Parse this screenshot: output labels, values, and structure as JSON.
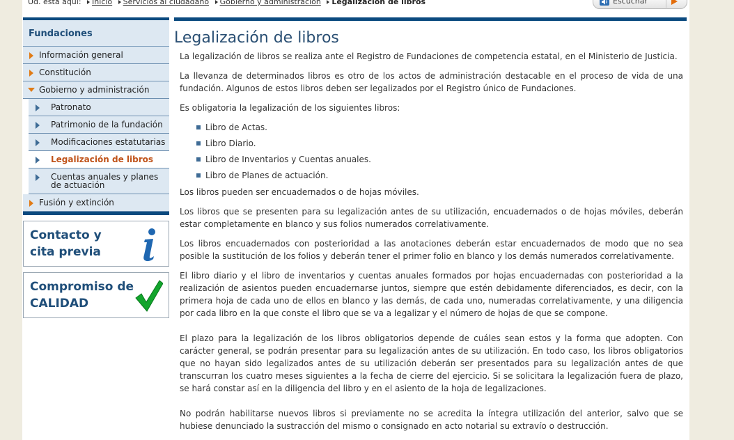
{
  "breadcrumb": {
    "prefix": "Ud. está aquí:",
    "items": [
      "Inicio",
      "Servicios al ciudadano",
      "Gobierno y administración"
    ],
    "current": "Legalización de libros"
  },
  "listen_button": {
    "label": "Escuchar"
  },
  "sidebar": {
    "heading": "Fundaciones",
    "items": [
      {
        "label": "Información general"
      },
      {
        "label": "Constitución"
      },
      {
        "label": "Gobierno y administración"
      }
    ],
    "subitems": [
      {
        "label": "Patronato"
      },
      {
        "label": "Patrimonio de la fundación"
      },
      {
        "label": "Modificaciones estatutarias"
      },
      {
        "label": "Legalización de libros"
      },
      {
        "label": "Cuentas anuales y planes de actuación"
      }
    ],
    "last_item": {
      "label": "Fusión y extinción"
    }
  },
  "promos": {
    "contact": {
      "line1": "Contacto y",
      "line2": "cita previa"
    },
    "quality": {
      "line1": "Compromiso de",
      "line2": "CALIDAD"
    }
  },
  "main": {
    "title": "Legalización de libros",
    "p1": "La legalización de libros se realiza ante el Registro de Fundaciones de competencia estatal, en el Ministerio de Justicia.",
    "p2": "La llevanza de determinados libros es otro de los actos de administración destacable en el proceso de vida de una fundación. Algunos de estos libros deben ser legalizados por el Registro único de Fundaciones.",
    "p3": "Es obligatoria la legalización de los siguientes libros:",
    "list": [
      "Libro de Actas.",
      "Libro Diario.",
      "Libro de Inventarios y Cuentas anuales.",
      "Libro de Planes de actuación."
    ],
    "p4": "Los libros pueden ser encuadernados o de hojas móviles.",
    "p5": "Los libros que se presenten para su legalización antes de su utilización, encuadernados o de hojas móviles, deberán estar completamente en blanco y sus folios numerados correlativamente.",
    "p6": "Los libros encuadernados con posterioridad a las anotaciones deberán estar encuadernados de modo que no sea posible la sustitución de los folios y deberán tener el primer folio en blanco y los demás numerados correlativamente.",
    "p7": "El libro diario y el libro de inventarios y cuentas anuales formados por hojas encuadernadas con posterioridad a la realización de asientos pueden encuadernarse juntos, siempre que estén debidamente diferenciados, es decir, con la primera hoja de cada uno de ellos en blanco y las demás, de cada uno, numeradas correlativamente, y una diligencia por cada libro en la que conste el libro que se va a legalizar y el número de hojas de que se compone.",
    "p8": "El plazo para la legalización de los libros obligatorios depende de cuáles sean estos y la forma que adopten. Con carácter general, se podrán presentar para su legalización antes de su utilización. En todo caso, los libros obligatorios que no hayan sido legalizados antes de su utilización deberán ser presentados para su legalización antes de que transcurran los cuatro meses siguientes a la fecha de cierre del ejercicio. Si se solicitara la legalización fuera de plazo, se hará constar así en la diligencia del libro y en el asiento de la hoja de legalizaciones.",
    "p9": "No podrán habilitarse nuevos libros si previamente no se acredita la íntegra utilización del anterior, salvo que se hubiese denunciado la sustracción del mismo o consignado en acto notarial su extravío o destrucción."
  }
}
